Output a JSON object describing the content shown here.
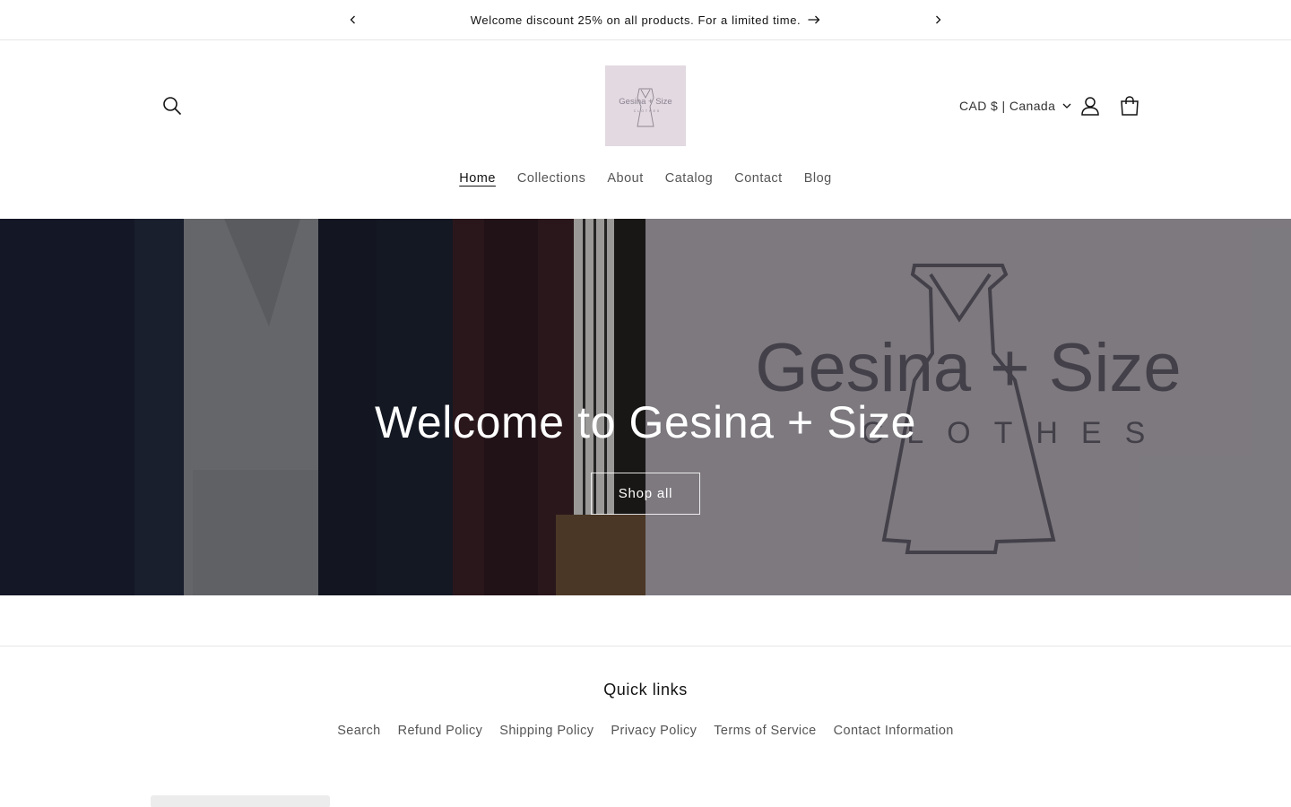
{
  "announcement": {
    "message": "Welcome discount 25% on all products. For a limited time.",
    "prev_label": "Previous announcement",
    "next_label": "Next announcement"
  },
  "header": {
    "logo_text": "Gesina + Size",
    "logo_sub": "CLOTHES",
    "currency": "CAD $ | Canada",
    "nav": [
      {
        "label": "Home",
        "active": true
      },
      {
        "label": "Collections"
      },
      {
        "label": "About"
      },
      {
        "label": "Catalog"
      },
      {
        "label": "Contact"
      },
      {
        "label": "Blog"
      }
    ]
  },
  "hero": {
    "title": "Welcome to Gesina + Size",
    "button_label": "Shop all",
    "watermark_text": "Gesina + Size",
    "watermark_sub": "CLOTHES"
  },
  "footer": {
    "heading": "Quick links",
    "links": [
      "Search",
      "Refund Policy",
      "Shipping Policy",
      "Privacy Policy",
      "Terms of Service",
      "Contact Information"
    ]
  },
  "colors": {
    "text": "#121212",
    "muted": "#555555",
    "logo_bg": "#e2d9e1",
    "hero_right_bg": "#8a868b"
  },
  "icons": [
    "chevron-left-icon",
    "chevron-right-icon",
    "arrow-right-icon",
    "search-icon",
    "account-icon",
    "cart-icon",
    "chevron-down-icon"
  ]
}
